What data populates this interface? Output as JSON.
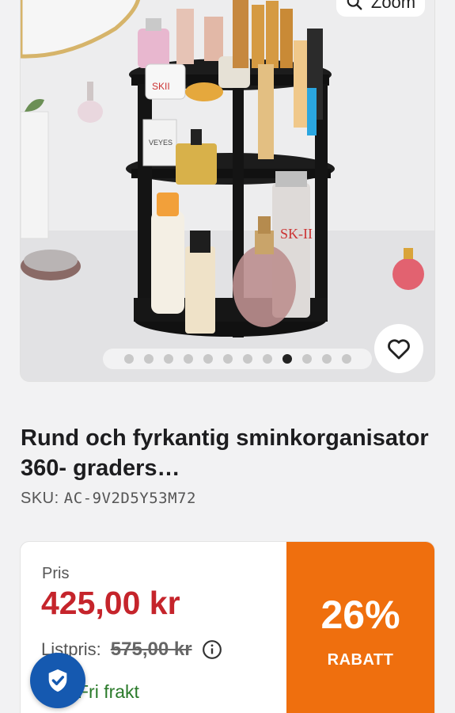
{
  "gallery": {
    "zoom_label": "Zoom",
    "dot_count": 12,
    "active_index": 8
  },
  "product": {
    "title": "Rund och fyrkantig sminkorganisator 360- graders…",
    "sku_label": "SKU:",
    "sku_value": "AC-9V2D5Y53M72"
  },
  "pricing": {
    "price_label": "Pris",
    "price": "425,00 kr",
    "list_label": "Listpris:",
    "list_price": "575,00 kr",
    "shipping": "Fri frakt",
    "discount_percent": "26%",
    "discount_label": "RABATT"
  },
  "colors": {
    "price_red": "#c5242b",
    "discount_orange": "#ef6f0e",
    "shield_blue": "#1559b0",
    "shipping_green": "#2a7a2a"
  }
}
